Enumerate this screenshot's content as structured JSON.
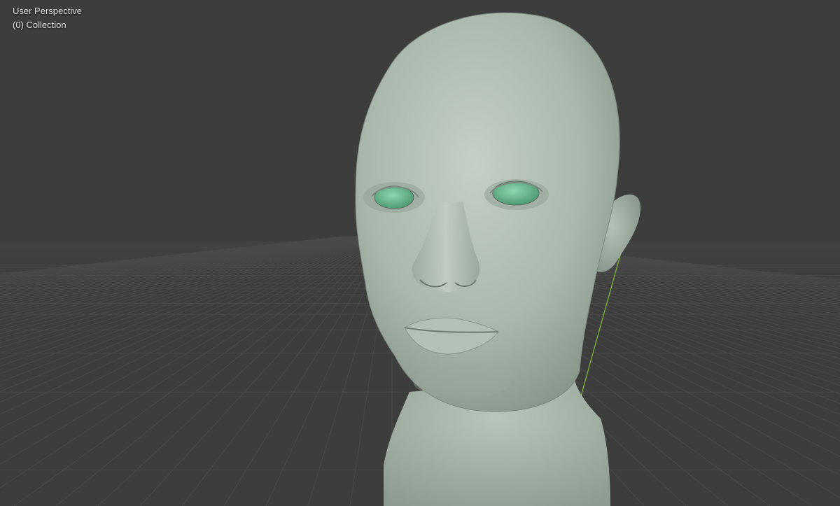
{
  "viewport": {
    "view_name": "User Perspective",
    "collection_label": "(0) Collection",
    "background_color": "#3d3d3d",
    "grid_color": "#4a4a4a",
    "y_axis_color": "#7fb33a",
    "mesh_color": "#a8b6ab",
    "eye_color": "#6fbf95"
  }
}
